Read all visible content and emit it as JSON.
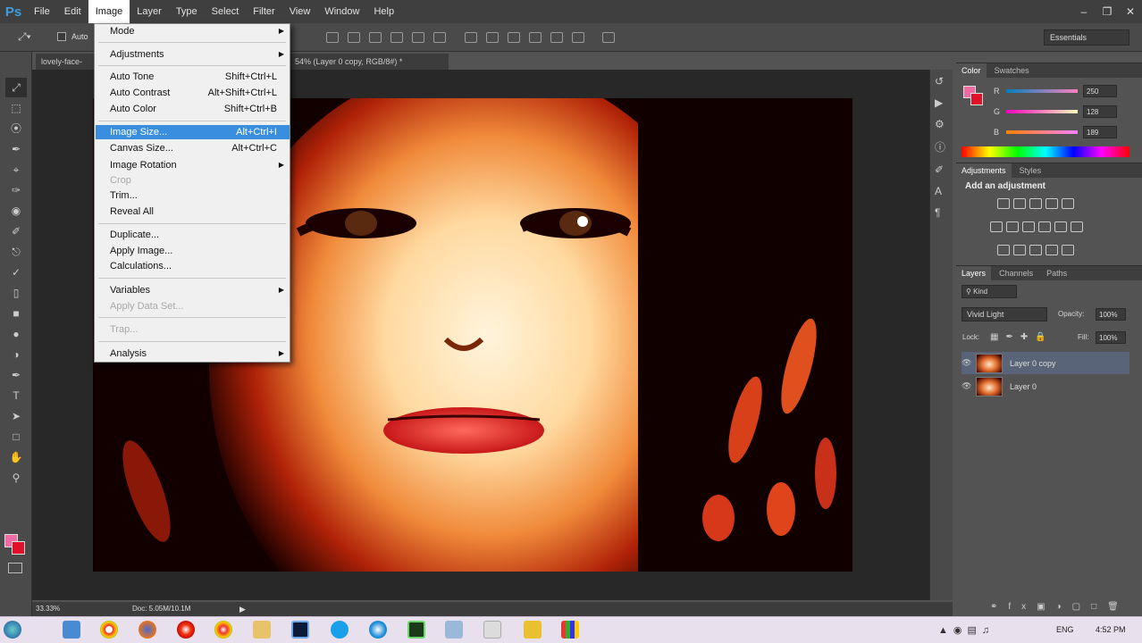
{
  "app": {
    "logo": "Ps"
  },
  "menubar": {
    "items": [
      "File",
      "Edit",
      "Image",
      "Layer",
      "Type",
      "Select",
      "Filter",
      "View",
      "Window",
      "Help"
    ],
    "active": "Image"
  },
  "options": {
    "auto_label": "Auto",
    "workspace": "Essentials"
  },
  "document": {
    "tab_title": "lovely-face-",
    "tab_title_2": "54% (Layer 0 copy, RGB/8#) *",
    "zoom": "33.33%",
    "doc_size": "Doc: 5.05M/10.1M"
  },
  "image_menu": {
    "items": [
      {
        "label": "Mode",
        "shortcut": "",
        "submenu": true,
        "disabled": false
      },
      {
        "label": "Adjustments",
        "shortcut": "",
        "submenu": true,
        "disabled": false
      },
      {
        "label": "Auto Tone",
        "shortcut": "Shift+Ctrl+L",
        "submenu": false,
        "disabled": false
      },
      {
        "label": "Auto Contrast",
        "shortcut": "Alt+Shift+Ctrl+L",
        "submenu": false,
        "disabled": false
      },
      {
        "label": "Auto Color",
        "shortcut": "Shift+Ctrl+B",
        "submenu": false,
        "disabled": false
      },
      {
        "label": "Image Size...",
        "shortcut": "Alt+Ctrl+I",
        "submenu": false,
        "disabled": false,
        "highlighted": true
      },
      {
        "label": "Canvas Size...",
        "shortcut": "Alt+Ctrl+C",
        "submenu": false,
        "disabled": false
      },
      {
        "label": "Image Rotation",
        "shortcut": "",
        "submenu": true,
        "disabled": false
      },
      {
        "label": "Crop",
        "shortcut": "",
        "submenu": false,
        "disabled": true
      },
      {
        "label": "Trim...",
        "shortcut": "",
        "submenu": false,
        "disabled": false
      },
      {
        "label": "Reveal All",
        "shortcut": "",
        "submenu": false,
        "disabled": false
      },
      {
        "label": "Duplicate...",
        "shortcut": "",
        "submenu": false,
        "disabled": false
      },
      {
        "label": "Apply Image...",
        "shortcut": "",
        "submenu": false,
        "disabled": false
      },
      {
        "label": "Calculations...",
        "shortcut": "",
        "submenu": false,
        "disabled": false
      },
      {
        "label": "Variables",
        "shortcut": "",
        "submenu": true,
        "disabled": false
      },
      {
        "label": "Apply Data Set...",
        "shortcut": "",
        "submenu": false,
        "disabled": true
      },
      {
        "label": "Trap...",
        "shortcut": "",
        "submenu": false,
        "disabled": true
      },
      {
        "label": "Analysis",
        "shortcut": "",
        "submenu": true,
        "disabled": false
      }
    ]
  },
  "color_panel": {
    "tabs": [
      "Color",
      "Swatches"
    ],
    "channels": [
      {
        "label": "R",
        "value": "250"
      },
      {
        "label": "G",
        "value": "128"
      },
      {
        "label": "B",
        "value": "189"
      }
    ],
    "fg_color": "#f06aa4",
    "bg_color": "#e0102a"
  },
  "adjustments_panel": {
    "tabs": [
      "Adjustments",
      "Styles"
    ],
    "heading": "Add an adjustment"
  },
  "layers_panel": {
    "tabs": [
      "Layers",
      "Channels",
      "Paths"
    ],
    "filter": "Kind",
    "blend_mode": "Vivid Light",
    "opacity_label": "Opacity:",
    "opacity": "100%",
    "lock_label": "Lock:",
    "fill_label": "Fill:",
    "fill": "100%",
    "layers": [
      {
        "name": "Layer 0 copy",
        "selected": true
      },
      {
        "name": "Layer 0",
        "selected": false
      }
    ]
  },
  "taskbar": {
    "language": "ENG",
    "time": "4:52 PM"
  }
}
